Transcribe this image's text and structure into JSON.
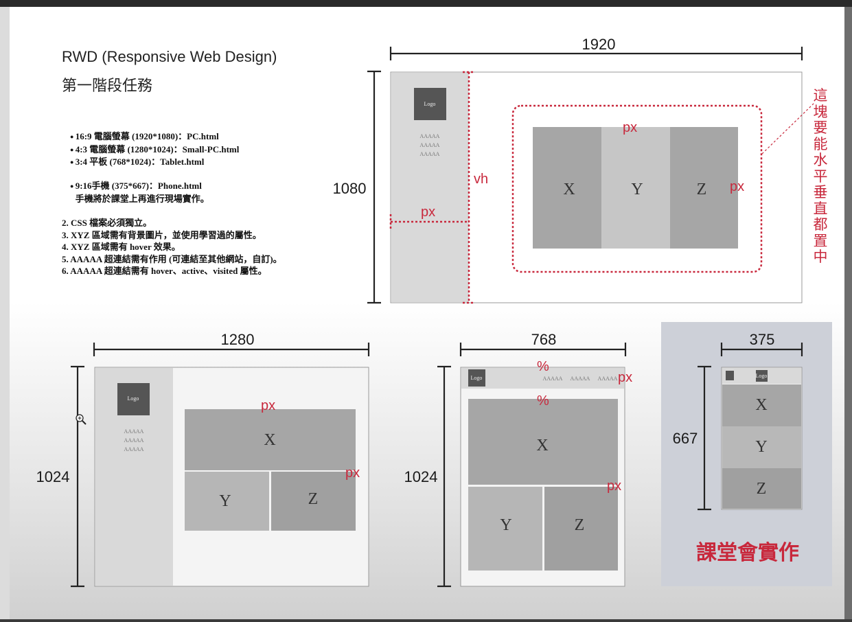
{
  "header": {
    "title": "RWD (Responsive Web Design)",
    "subtitle": "第一階段任務"
  },
  "tasks": {
    "devices": [
      "16:9 電腦螢幕 (1920*1080)：PC.html",
      "4:3 電腦螢幕 (1280*1024)：Small-PC.html",
      "3:4 平板 (768*1024)：Tablet.html"
    ],
    "phone": "9:16手機 (375*667)：Phone.html",
    "phone_note": "手機將於課堂上再進行現場實作。",
    "rules": [
      "2. CSS 檔案必須獨立。",
      "3. XYZ 區域需有背景圖片，並使用學習過的屬性。",
      "4. XYZ 區域需有 hover 效果。",
      "5. AAAAA 超連結需有作用 (可連結至其他網站，自訂)。",
      "6. AAAAA 超連結需有 hover、active、visited 屬性。"
    ]
  },
  "pc": {
    "width": "1920",
    "height": "1080",
    "logo": "Logo",
    "links": [
      "AAAAA",
      "AAAAA",
      "AAAAA"
    ],
    "label_vh": "vh",
    "label_px_side": "px",
    "label_px_top": "px",
    "label_px_right": "px",
    "cells": [
      "X",
      "Y",
      "Z"
    ],
    "center_note": "這塊要能水平垂直都置中"
  },
  "small_pc": {
    "width": "1280",
    "height": "1024",
    "logo": "Logo",
    "links": [
      "AAAAA",
      "AAAAA",
      "AAAAA"
    ],
    "label_px_top": "px",
    "label_px_right": "px",
    "cells": [
      "X",
      "Y",
      "Z"
    ]
  },
  "tablet": {
    "width": "768",
    "height": "1024",
    "logo": "Logo",
    "links": [
      "AAAAA",
      "AAAAA",
      "AAAAA"
    ],
    "label_pct_top": "%",
    "label_pct_mid": "%",
    "label_px_nav": "px",
    "label_px_right": "px",
    "cells": [
      "X",
      "Y",
      "Z"
    ]
  },
  "phone": {
    "width": "375",
    "height": "667",
    "logo": "Logo",
    "cells": [
      "X",
      "Y",
      "Z"
    ],
    "class_note": "課堂會實作"
  },
  "colors": {
    "accent_red": "#c8283c",
    "cell_dark": "#a6a6a6",
    "cell_light": "#c6c6c6",
    "sidebar": "#d9d9d9",
    "logo_box": "#555555",
    "phone_panel": "#cdd0d8"
  }
}
